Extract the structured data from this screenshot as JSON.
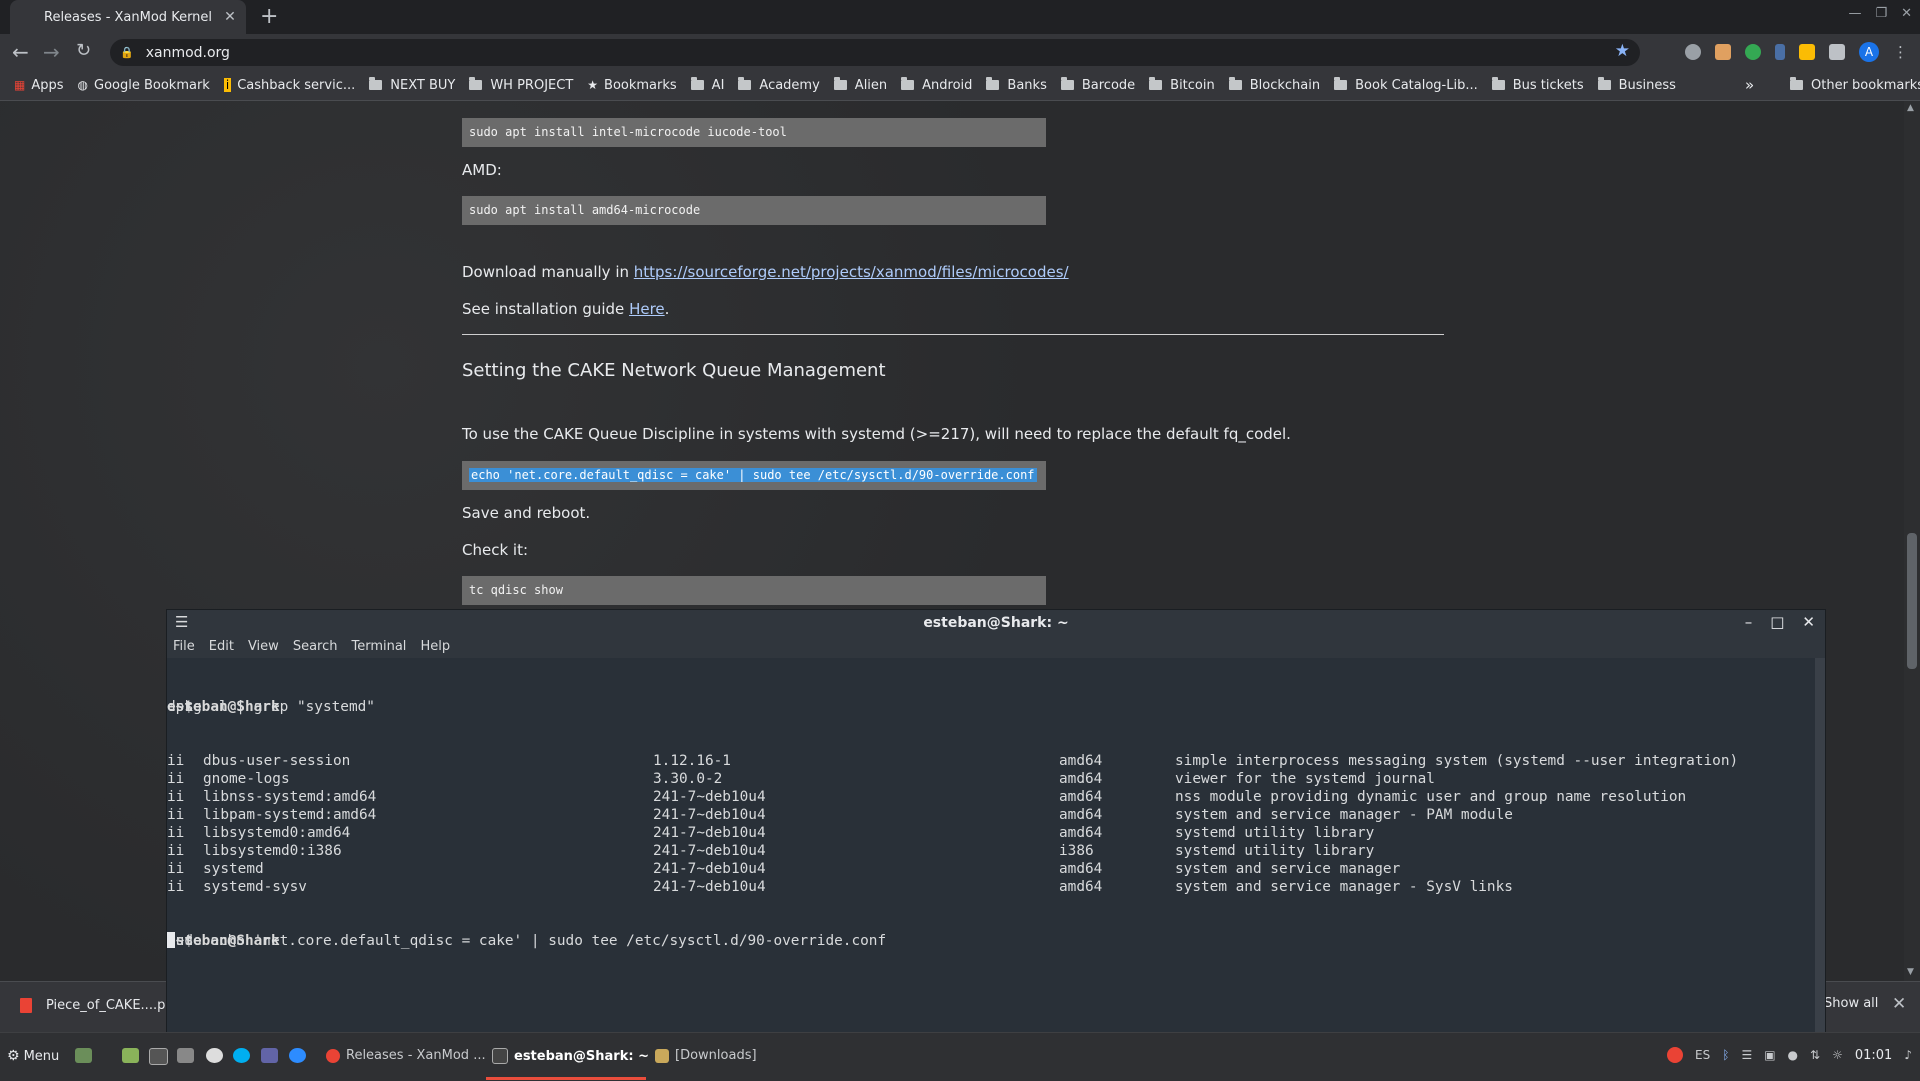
{
  "browser": {
    "tab_title": "Releases - XanMod Kernel",
    "url": "xanmod.org",
    "bookmarks": [
      "Apps",
      "Google Bookmark",
      "Cashback servic...",
      "NEXT BUY",
      "WH PROJECT",
      "Bookmarks",
      "AI",
      "Academy",
      "Alien",
      "Android",
      "Banks",
      "Barcode",
      "Bitcoin",
      "Blockchain",
      "Book Catalog-Lib...",
      "Bus tickets",
      "Business"
    ],
    "other_bookmarks": "Other bookmarks",
    "profile_initial": "A"
  },
  "page": {
    "code_intel": "sudo apt install intel-microcode iucode-tool",
    "amd_label": "AMD:",
    "code_amd": "sudo apt install amd64-microcode",
    "download_prefix": "Download manually in ",
    "download_link": "https://sourceforge.net/projects/xanmod/files/microcodes/",
    "guide_prefix": "See installation guide ",
    "guide_link": "Here",
    "guide_suffix": ".",
    "heading": "Setting the CAKE Network Queue Management",
    "cake_text": "To use the CAKE Queue Discipline in systems with systemd (>=217), will need to replace the default fq_codel.",
    "code_cake": "echo 'net.core.default_qdisc = cake' | sudo tee /etc/sysctl.d/90-override.conf",
    "save_text": "Save and reboot.",
    "check_text": "Check it:",
    "code_check": "tc qdisc show"
  },
  "downloads": {
    "file": "Piece_of_CAKE....pdf",
    "show_all": "Show all"
  },
  "terminal": {
    "title": "esteban@Shark: ~",
    "menu": [
      "File",
      "Edit",
      "View",
      "Search",
      "Terminal",
      "Help"
    ],
    "prompt": "esteban@Shark",
    "prompt_suffix": ":~$ ",
    "cmd1": "dpkg -l | grep \"systemd\"",
    "rows": [
      {
        "st": "ii",
        "name": "dbus-user-session",
        "ver": "1.12.16-1",
        "arch": "amd64",
        "desc": "simple interprocess messaging system (systemd --user integration)"
      },
      {
        "st": "ii",
        "name": "gnome-logs",
        "ver": "3.30.0-2",
        "arch": "amd64",
        "desc": "viewer for the systemd journal"
      },
      {
        "st": "ii",
        "name": "libnss-systemd:amd64",
        "ver": "241-7~deb10u4",
        "arch": "amd64",
        "desc": "nss module providing dynamic user and group name resolution"
      },
      {
        "st": "ii",
        "name": "libpam-systemd:amd64",
        "ver": "241-7~deb10u4",
        "arch": "amd64",
        "desc": "system and service manager - PAM module"
      },
      {
        "st": "ii",
        "name": "libsystemd0:amd64",
        "ver": "241-7~deb10u4",
        "arch": "amd64",
        "desc": "systemd utility library"
      },
      {
        "st": "ii",
        "name": "libsystemd0:i386",
        "ver": "241-7~deb10u4",
        "arch": "i386",
        "desc": "systemd utility library"
      },
      {
        "st": "ii",
        "name": "systemd",
        "ver": "241-7~deb10u4",
        "arch": "amd64",
        "desc": "system and service manager"
      },
      {
        "st": "ii",
        "name": "systemd-sysv",
        "ver": "241-7~deb10u4",
        "arch": "amd64",
        "desc": "system and service manager - SysV links"
      }
    ],
    "cmd2": "sudo echo 'net.core.default_qdisc = cake' | sudo tee /etc/sysctl.d/90-override.conf"
  },
  "taskbar": {
    "menu": "Menu",
    "tasks": [
      "Releases - XanMod ...",
      "esteban@Shark: ~",
      "[Downloads]"
    ],
    "lang": "ES",
    "clock": "01:01"
  }
}
